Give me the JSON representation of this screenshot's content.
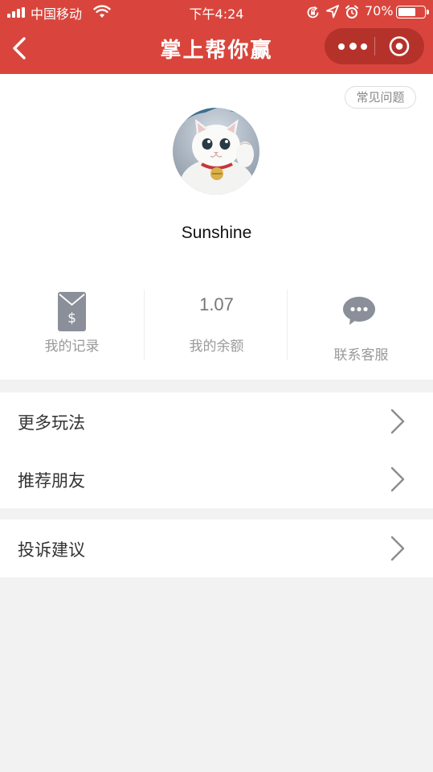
{
  "status_bar": {
    "carrier": "中国移动",
    "time": "下午4:24",
    "battery_percent": "70%",
    "battery_level": 0.7,
    "icons": [
      "signal-icon",
      "wifi-icon",
      "rotation-lock-icon",
      "location-icon",
      "alarm-icon",
      "battery-icon"
    ]
  },
  "nav": {
    "title": "掌上帮你赢",
    "back_icon": "chevron-left-icon",
    "more_icon": "more-dots-icon",
    "close_icon": "target-close-icon"
  },
  "profile": {
    "faq_label": "常见问题",
    "username": "Sunshine"
  },
  "stats": [
    {
      "label": "我的记录",
      "icon": "red-envelope-dollar-icon"
    },
    {
      "label": "我的余额",
      "value": "1.07"
    },
    {
      "label": "联系客服",
      "icon": "chat-bubble-icon"
    }
  ],
  "menu": {
    "group1": [
      {
        "label": "更多玩法"
      },
      {
        "label": "推荐朋友"
      }
    ],
    "group2": [
      {
        "label": "投诉建议"
      }
    ]
  },
  "colors": {
    "header_bg": "#d9453c",
    "capsule_bg": "#b5322b",
    "page_bg": "#f2f2f2",
    "icon_gray": "#8a8f99"
  }
}
